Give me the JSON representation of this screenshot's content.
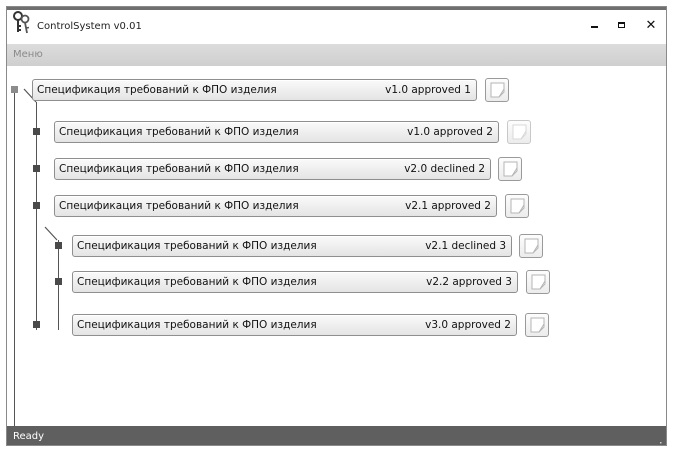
{
  "window": {
    "title": "ControlSystem v0.01",
    "app_icon": "keys-icon",
    "controls": [
      "minimize-icon",
      "maximize-icon",
      "close-icon"
    ]
  },
  "menu": {
    "items": [
      {
        "label": "Меню"
      }
    ]
  },
  "specs": [
    {
      "title": "Спецификация требований к ФПО изделия",
      "status": "v1.0 approved 1",
      "level": 0
    },
    {
      "title": "Спецификация требований к ФПО изделия",
      "status": "v1.0 approved 2",
      "level": 1
    },
    {
      "title": "Спецификация требований к ФПО изделия",
      "status": "v2.0 declined 2",
      "level": 1
    },
    {
      "title": "Спецификация требований к ФПО изделия",
      "status": "v2.1 approved 2",
      "level": 1
    },
    {
      "title": "Спецификация требований к ФПО изделия",
      "status": "v2.1 declined 3",
      "level": 2
    },
    {
      "title": "Спецификация требований к ФПО изделия",
      "status": "v2.2 approved 3",
      "level": 2
    },
    {
      "title": "Спецификация требований к ФПО изделия",
      "status": "v3.0 approved 2",
      "level": 2
    }
  ],
  "status_bar": {
    "text": "Ready"
  }
}
